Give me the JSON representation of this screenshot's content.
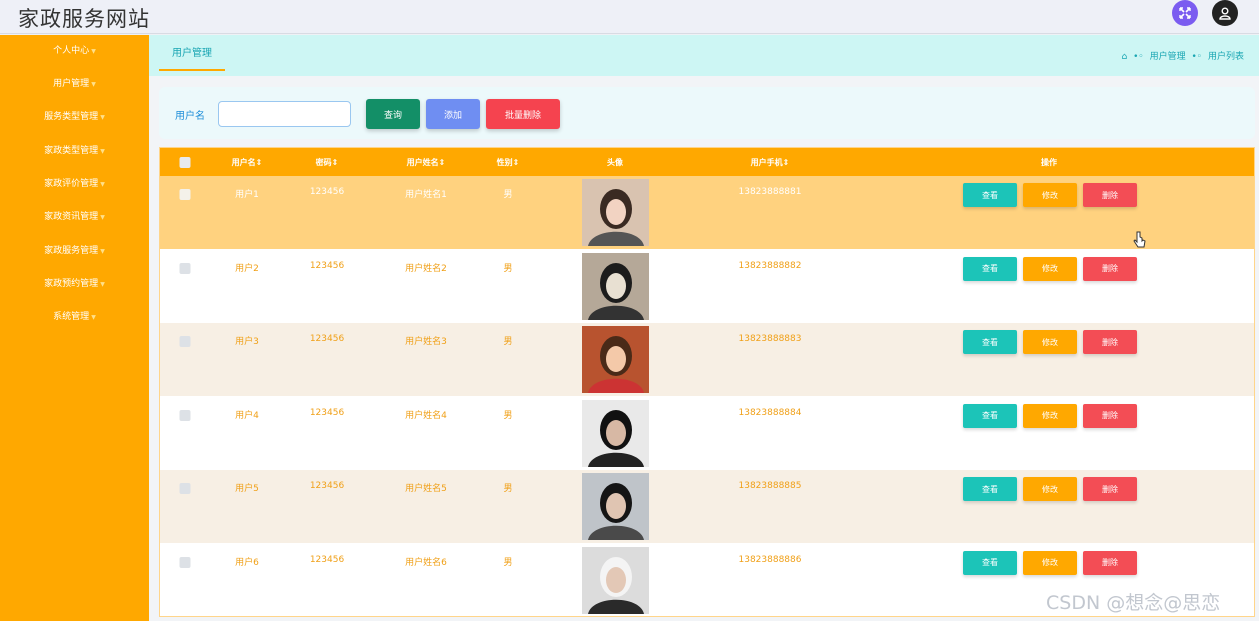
{
  "header": {
    "title": "家政服务网站",
    "expand_icon": "expand-icon",
    "user_icon": "user-icon"
  },
  "sidebar": {
    "items": [
      {
        "label": "个人中心"
      },
      {
        "label": "用户管理"
      },
      {
        "label": "服务类型管理"
      },
      {
        "label": "家政类型管理"
      },
      {
        "label": "家政评价管理"
      },
      {
        "label": "家政资讯管理"
      },
      {
        "label": "家政服务管理"
      },
      {
        "label": "家政预约管理"
      },
      {
        "label": "系统管理"
      }
    ]
  },
  "main": {
    "tab": "用户管理",
    "breadcrumb": [
      "用户管理",
      "用户列表"
    ],
    "search": {
      "label": "用户名",
      "value": "",
      "placeholder": ""
    },
    "buttons": {
      "search": "查询",
      "add": "添加",
      "batch_delete": "批量删除"
    },
    "columns": [
      "用户名",
      "密码",
      "用户姓名",
      "性别",
      "头像",
      "用户手机",
      "操作"
    ],
    "actions": {
      "view": "查看",
      "edit": "修改",
      "delete": "删除"
    },
    "rows": [
      {
        "username": "用户1",
        "password": "123456",
        "name": "用户姓名1",
        "gender": "男",
        "phone": "13823888881"
      },
      {
        "username": "用户2",
        "password": "123456",
        "name": "用户姓名2",
        "gender": "男",
        "phone": "13823888882"
      },
      {
        "username": "用户3",
        "password": "123456",
        "name": "用户姓名3",
        "gender": "男",
        "phone": "13823888883"
      },
      {
        "username": "用户4",
        "password": "123456",
        "name": "用户姓名4",
        "gender": "男",
        "phone": "13823888884"
      },
      {
        "username": "用户5",
        "password": "123456",
        "name": "用户姓名5",
        "gender": "男",
        "phone": "13823888885"
      },
      {
        "username": "用户6",
        "password": "123456",
        "name": "用户姓名6",
        "gender": "男",
        "phone": "13823888886"
      }
    ]
  },
  "colors": {
    "accent": "#ffa800",
    "teal": "#1cc4b8",
    "danger": "#f34d55",
    "highlight_row": "#ffd27f",
    "alt_row": "#f7efe4"
  },
  "watermark": "CSDN @想念@思恋"
}
